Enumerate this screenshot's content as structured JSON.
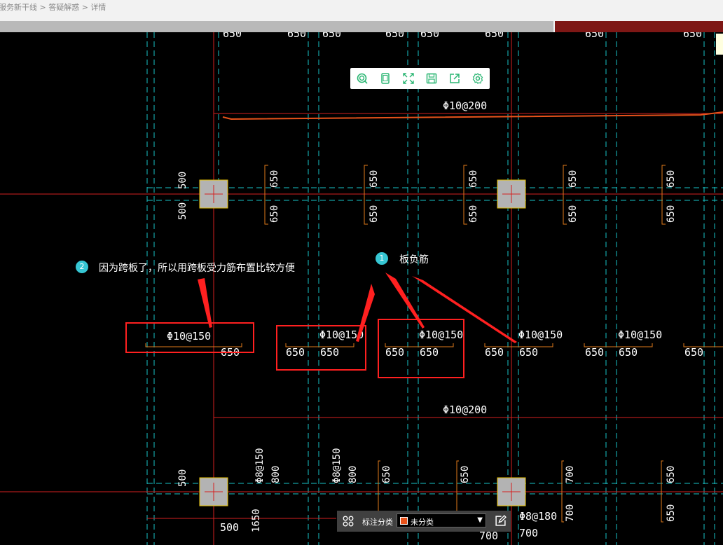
{
  "header": {
    "breadcrumb": "服务新干线 > 答疑解惑 > 详情"
  },
  "toolbar": {
    "buttons": [
      {
        "name": "zoom-icon"
      },
      {
        "name": "tablet-icon"
      },
      {
        "name": "fullscreen-icon"
      },
      {
        "name": "save-icon"
      },
      {
        "name": "share-icon"
      },
      {
        "name": "settings-icon"
      }
    ],
    "accent": "#2bb673"
  },
  "annotations": {
    "note1": {
      "badge": "1",
      "text": "板负筋"
    },
    "note2": {
      "badge": "2",
      "text": "因为跨板了，所以用跨板受力筋布置比较方便"
    }
  },
  "drawing": {
    "top_dims": [
      "650",
      "650",
      "650",
      "650",
      "650",
      "650",
      "650",
      "650"
    ],
    "rebar_top": "Φ10@200",
    "rebar_mid": "Φ10@200",
    "col_dims_upper": [
      "650",
      "650",
      "650",
      "650",
      "650",
      "650",
      "650",
      "650",
      "650",
      "650",
      "650",
      "650"
    ],
    "col_500": "500",
    "row_rebar": [
      "Φ10@150",
      "Φ10@150",
      "Φ10@150",
      "Φ10@150",
      "Φ10@150"
    ],
    "row_650": [
      "650",
      "650",
      "650",
      "650",
      "650",
      "650",
      "650",
      "650",
      "650",
      "650"
    ],
    "bottom_rebar": [
      "Φ8@150",
      "Φ8@150",
      "Φ8@180"
    ],
    "bottom_dims": [
      "800",
      "800",
      "650",
      "650",
      "700",
      "700",
      "650",
      "650",
      "500",
      "1650",
      "500",
      "700",
      "700"
    ],
    "colors": {
      "grid": "#19c3c8",
      "axis": "#d42020",
      "dims": "#e07a1a",
      "column": "#c0c0c0",
      "highlight": "#ff2020"
    }
  },
  "bottombar": {
    "label": "标注分类",
    "value": "未分类",
    "swatch": "#e8531b"
  }
}
